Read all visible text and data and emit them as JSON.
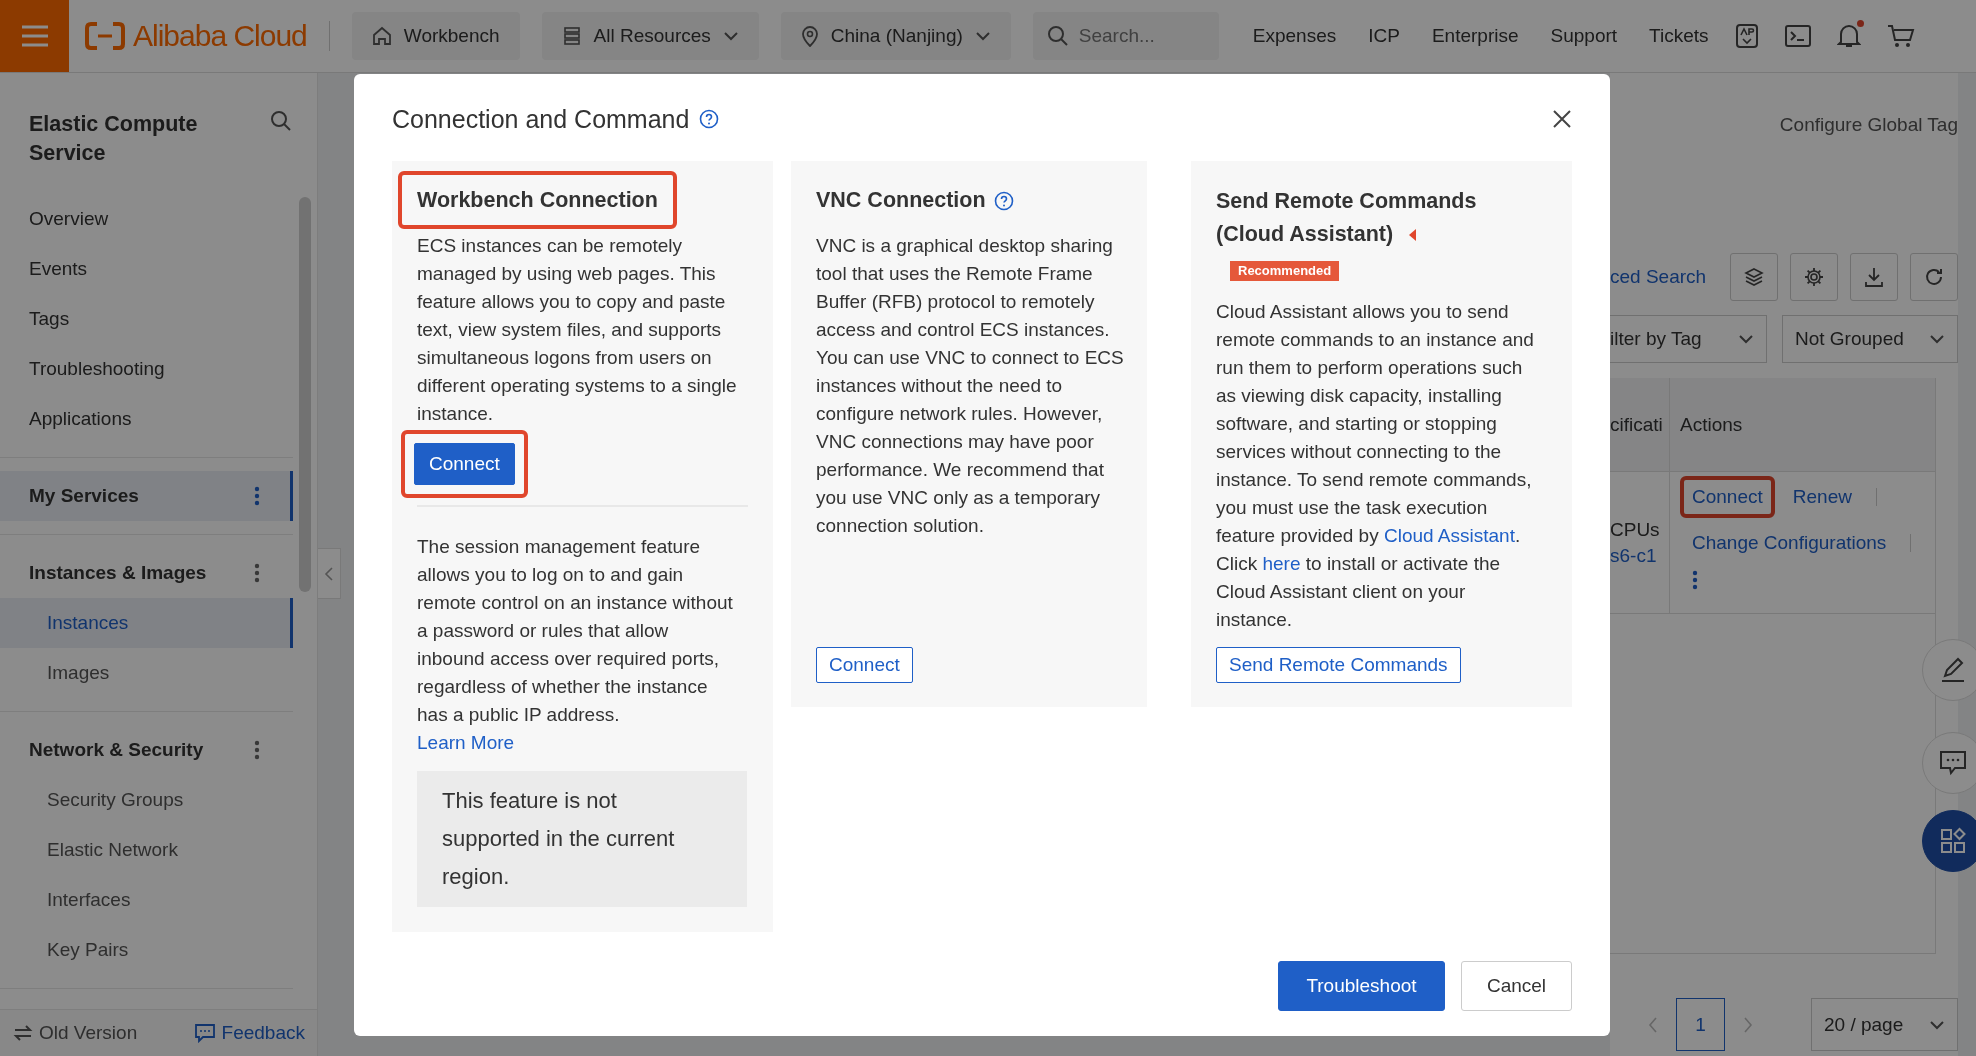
{
  "topbar": {
    "logo": "Alibaba Cloud",
    "pills": [
      {
        "kind": "home",
        "label": "Workbench",
        "dropdown": false
      },
      {
        "kind": "resources",
        "label": "All Resources",
        "dropdown": true
      },
      {
        "kind": "location",
        "label": "China (Nanjing)",
        "dropdown": true
      }
    ],
    "search": {
      "placeholder": "Search..."
    },
    "links": [
      "Expenses",
      "ICP",
      "Enterprise",
      "Support",
      "Tickets"
    ],
    "notifications_unread": true
  },
  "sidebar": {
    "title": "Elastic Compute Service",
    "sections": [
      {
        "items": [
          {
            "label": "Overview",
            "selected": false
          },
          {
            "label": "Events",
            "selected": false
          },
          {
            "label": "Tags",
            "selected": false
          },
          {
            "label": "Troubleshooting",
            "selected": false
          },
          {
            "label": "Applications",
            "selected": false
          }
        ]
      },
      {
        "heading": "My Services",
        "selected": true
      },
      {
        "heading": "Instances & Images",
        "selected": false,
        "items": [
          {
            "label": "Instances",
            "selected": true
          },
          {
            "label": "Images",
            "selected": false
          }
        ]
      },
      {
        "heading": "Network & Security",
        "selected": false,
        "items": [
          {
            "label": "Security Groups",
            "selected": false
          },
          {
            "label": "Elastic Network",
            "selected": false
          },
          {
            "label": "Interfaces",
            "selected": false
          },
          {
            "label": "Key Pairs",
            "selected": false
          }
        ]
      }
    ],
    "footer": {
      "old_version": "Old Version",
      "feedback": "Feedback"
    }
  },
  "page": {
    "configure_tag": "Configure Global Tag",
    "advanced_search": "ced Search",
    "tag_filter": "ilter by Tag",
    "grouping": "Not Grouped",
    "table": {
      "columns": [
        "cificati",
        "Actions"
      ],
      "rows": [
        {
          "column_1_lines": [
            "CPUs",
            "s6-c1"
          ],
          "actions": [
            {
              "label": "Connect",
              "highlighted": true
            },
            {
              "label": "Renew",
              "highlighted": false
            },
            {
              "label": "Change Configurations",
              "highlighted": false
            }
          ]
        }
      ]
    },
    "pagination": {
      "pages": [
        {
          "label": "1",
          "selected": true
        }
      ],
      "page_size": "20 / page"
    }
  },
  "dialog": {
    "title": "Connection and Command",
    "help": true,
    "methods": [
      {
        "title": "Workbench Connection",
        "title_highlighted": true,
        "help": false,
        "description": [
          {
            "kind": "text",
            "text": "ECS instances can be remotely managed by using web pages. This feature allows you to copy and paste text, view system files, and supports simultaneous logons from users on different operating systems to a single instance."
          }
        ],
        "button": {
          "label": "Connect",
          "primary": true,
          "highlighted": true
        },
        "session": {
          "description": "The session management feature allows you to log on to and gain remote control on an instance without a password or rules that allow inbound access over required ports, regardless of whether the instance has a public IP address.",
          "link": "Learn More",
          "notice": "This feature is not supported in the current region."
        }
      },
      {
        "title": "VNC Connection",
        "title_highlighted": false,
        "help": true,
        "description": [
          {
            "kind": "text",
            "text": "VNC is a graphical desktop sharing tool that uses the Remote Frame Buffer (RFB) protocol to remotely access and control ECS instances. You can use VNC to connect to ECS instances without the need to configure network rules. However, VNC connections may have poor performance. We recommend that you use VNC only as a temporary connection solution."
          }
        ],
        "button": {
          "label": "Connect",
          "primary": false,
          "highlighted": false
        }
      },
      {
        "title": "Send Remote Commands (Cloud Assistant)",
        "title_highlighted": false,
        "help": false,
        "badge": "Recommended",
        "description": [
          {
            "kind": "text",
            "text": "Cloud Assistant allows you to send remote commands to an instance and run them to perform operations such as viewing disk capacity, installing software, and starting or stopping services without connecting to the instance. To send remote commands, you must use the task execution feature provided by "
          },
          {
            "kind": "link",
            "text": "Cloud Assistant"
          },
          {
            "kind": "text",
            "text": ". Click "
          },
          {
            "kind": "link",
            "text": "here"
          },
          {
            "kind": "text",
            "text": " to install or activate the Cloud Assistant client on your instance."
          }
        ],
        "button": {
          "label": "Send Remote Commands",
          "primary": false,
          "highlighted": false
        }
      }
    ],
    "buttons": [
      {
        "label": "Troubleshoot",
        "primary": true
      },
      {
        "label": "Cancel",
        "primary": false
      }
    ]
  }
}
